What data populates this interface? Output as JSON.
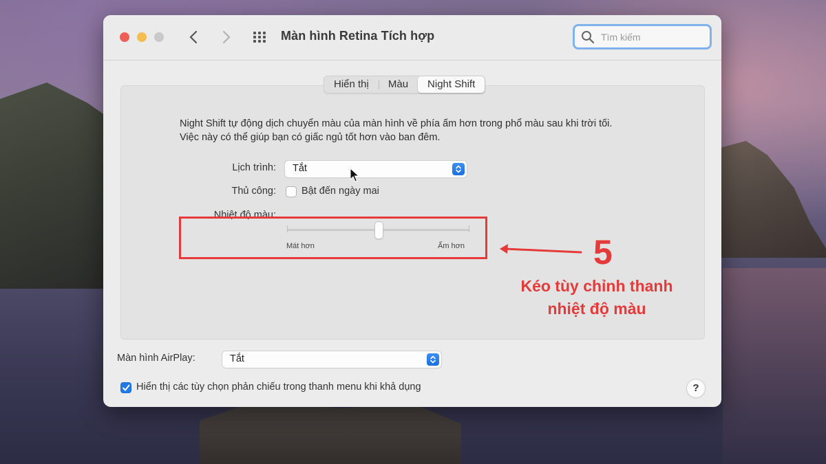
{
  "window": {
    "title": "Màn hình Retina Tích hợp",
    "search_placeholder": "Tìm kiếm"
  },
  "tabs": [
    {
      "label": "Hiển thị",
      "active": false
    },
    {
      "label": "Màu",
      "active": false
    },
    {
      "label": "Night Shift",
      "active": true
    }
  ],
  "night_shift": {
    "description": "Night Shift tự động dịch chuyển màu của màn hình về phía ấm hơn trong phổ màu sau khi trời tối. Việc này có thể giúp bạn có giấc ngủ tốt hơn vào ban đêm.",
    "schedule_label": "Lịch trình:",
    "schedule_value": "Tắt",
    "manual_label": "Thủ công:",
    "manual_checkbox_label": "Bật đến ngày mai",
    "manual_checked": false,
    "temperature_label": "Nhiệt độ màu:",
    "temperature_min_label": "Mát hơn",
    "temperature_max_label": "Ấm hơn",
    "temperature_level": 0.5
  },
  "airplay": {
    "label": "Màn hình AirPlay:",
    "value": "Tắt"
  },
  "mirroring": {
    "label": "Hiển thị các tùy chọn phản chiếu trong thanh menu khi khả dụng",
    "checked": true
  },
  "help_label": "?",
  "annotation": {
    "step_number": "5",
    "line1": "Kéo tùy chỉnh thanh",
    "line2": "nhiệt độ màu",
    "color": "#e53a3a"
  },
  "colors": {
    "accent": "#1f78e6",
    "highlight": "#e5393b"
  }
}
